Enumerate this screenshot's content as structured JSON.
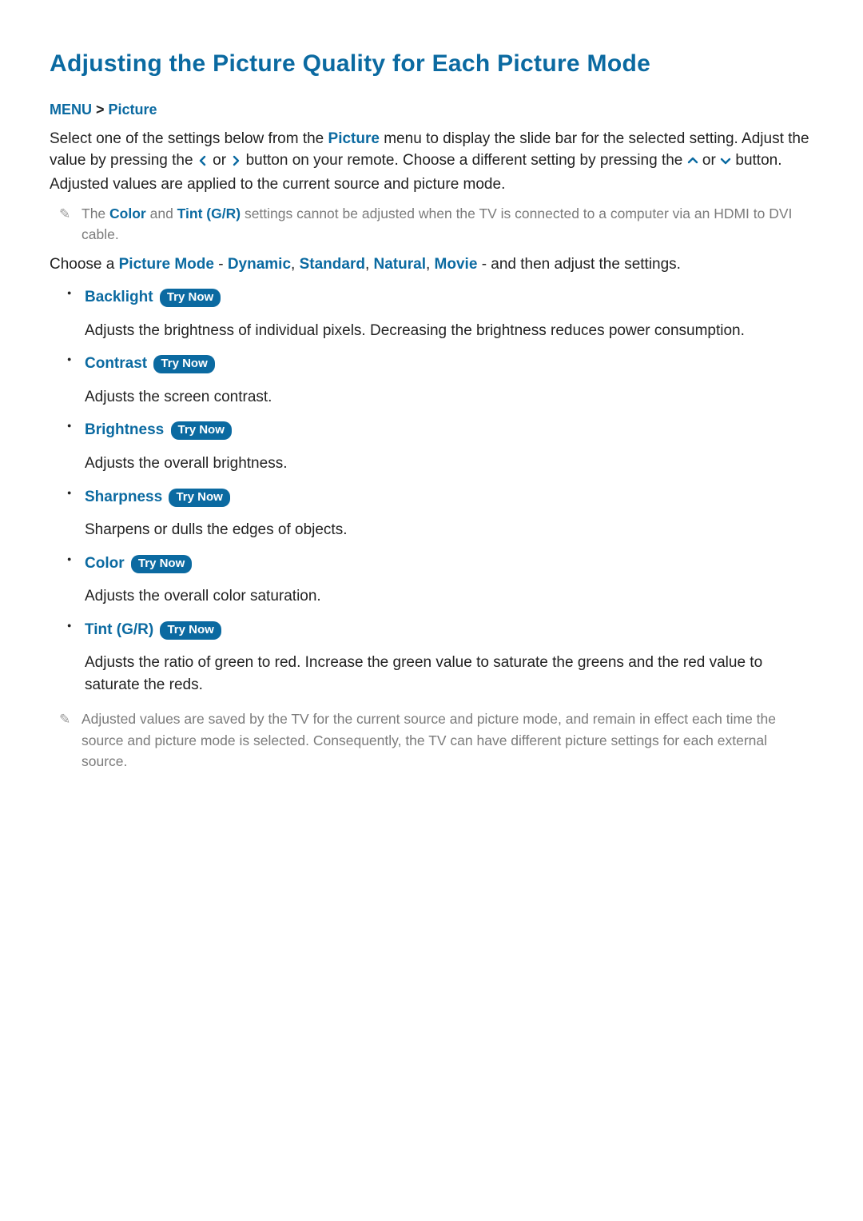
{
  "title": "Adjusting the Picture Quality for Each Picture Mode",
  "breadcrumb": {
    "menu": "MENU",
    "sep": ">",
    "picture": "Picture"
  },
  "intro": {
    "part1": "Select one of the settings below from the ",
    "kw_picture": "Picture",
    "part2": " menu to display the slide bar for the selected setting. Adjust the value by pressing the ",
    "part3": " or ",
    "part4": " button on your remote. Choose a different setting by pressing the ",
    "part5": " or ",
    "part6": " button. Adjusted values are applied to the current source and picture mode."
  },
  "note1": {
    "pre": "The ",
    "kw_color": "Color",
    "mid": " and ",
    "kw_tint": "Tint (G/R)",
    "post": " settings cannot be adjusted when the TV is connected to a computer via an HDMI to DVI cable."
  },
  "choose": {
    "pre": "Choose a ",
    "kw_pm": "Picture Mode",
    "dash1": " - ",
    "m1": "Dynamic",
    "c1": ", ",
    "m2": "Standard",
    "c2": ", ",
    "m3": "Natural",
    "c3": ", ",
    "m4": "Movie",
    "dash2": " - and then adjust the settings."
  },
  "try_now_label": "Try Now",
  "settings": [
    {
      "name": "Backlight",
      "desc": "Adjusts the brightness of individual pixels. Decreasing the brightness reduces power consumption."
    },
    {
      "name": "Contrast",
      "desc": "Adjusts the screen contrast."
    },
    {
      "name": "Brightness",
      "desc": "Adjusts the overall brightness."
    },
    {
      "name": "Sharpness",
      "desc": "Sharpens or dulls the edges of objects."
    },
    {
      "name": "Color",
      "desc": "Adjusts the overall color saturation."
    },
    {
      "name": "Tint (G/R)",
      "desc": "Adjusts the ratio of green to red. Increase the green value to saturate the greens and the red value to saturate the reds."
    }
  ],
  "note2": "Adjusted values are saved by the TV for the current source and picture mode, and remain in effect each time the source and picture mode is selected. Consequently, the TV can have different picture settings for each external source."
}
